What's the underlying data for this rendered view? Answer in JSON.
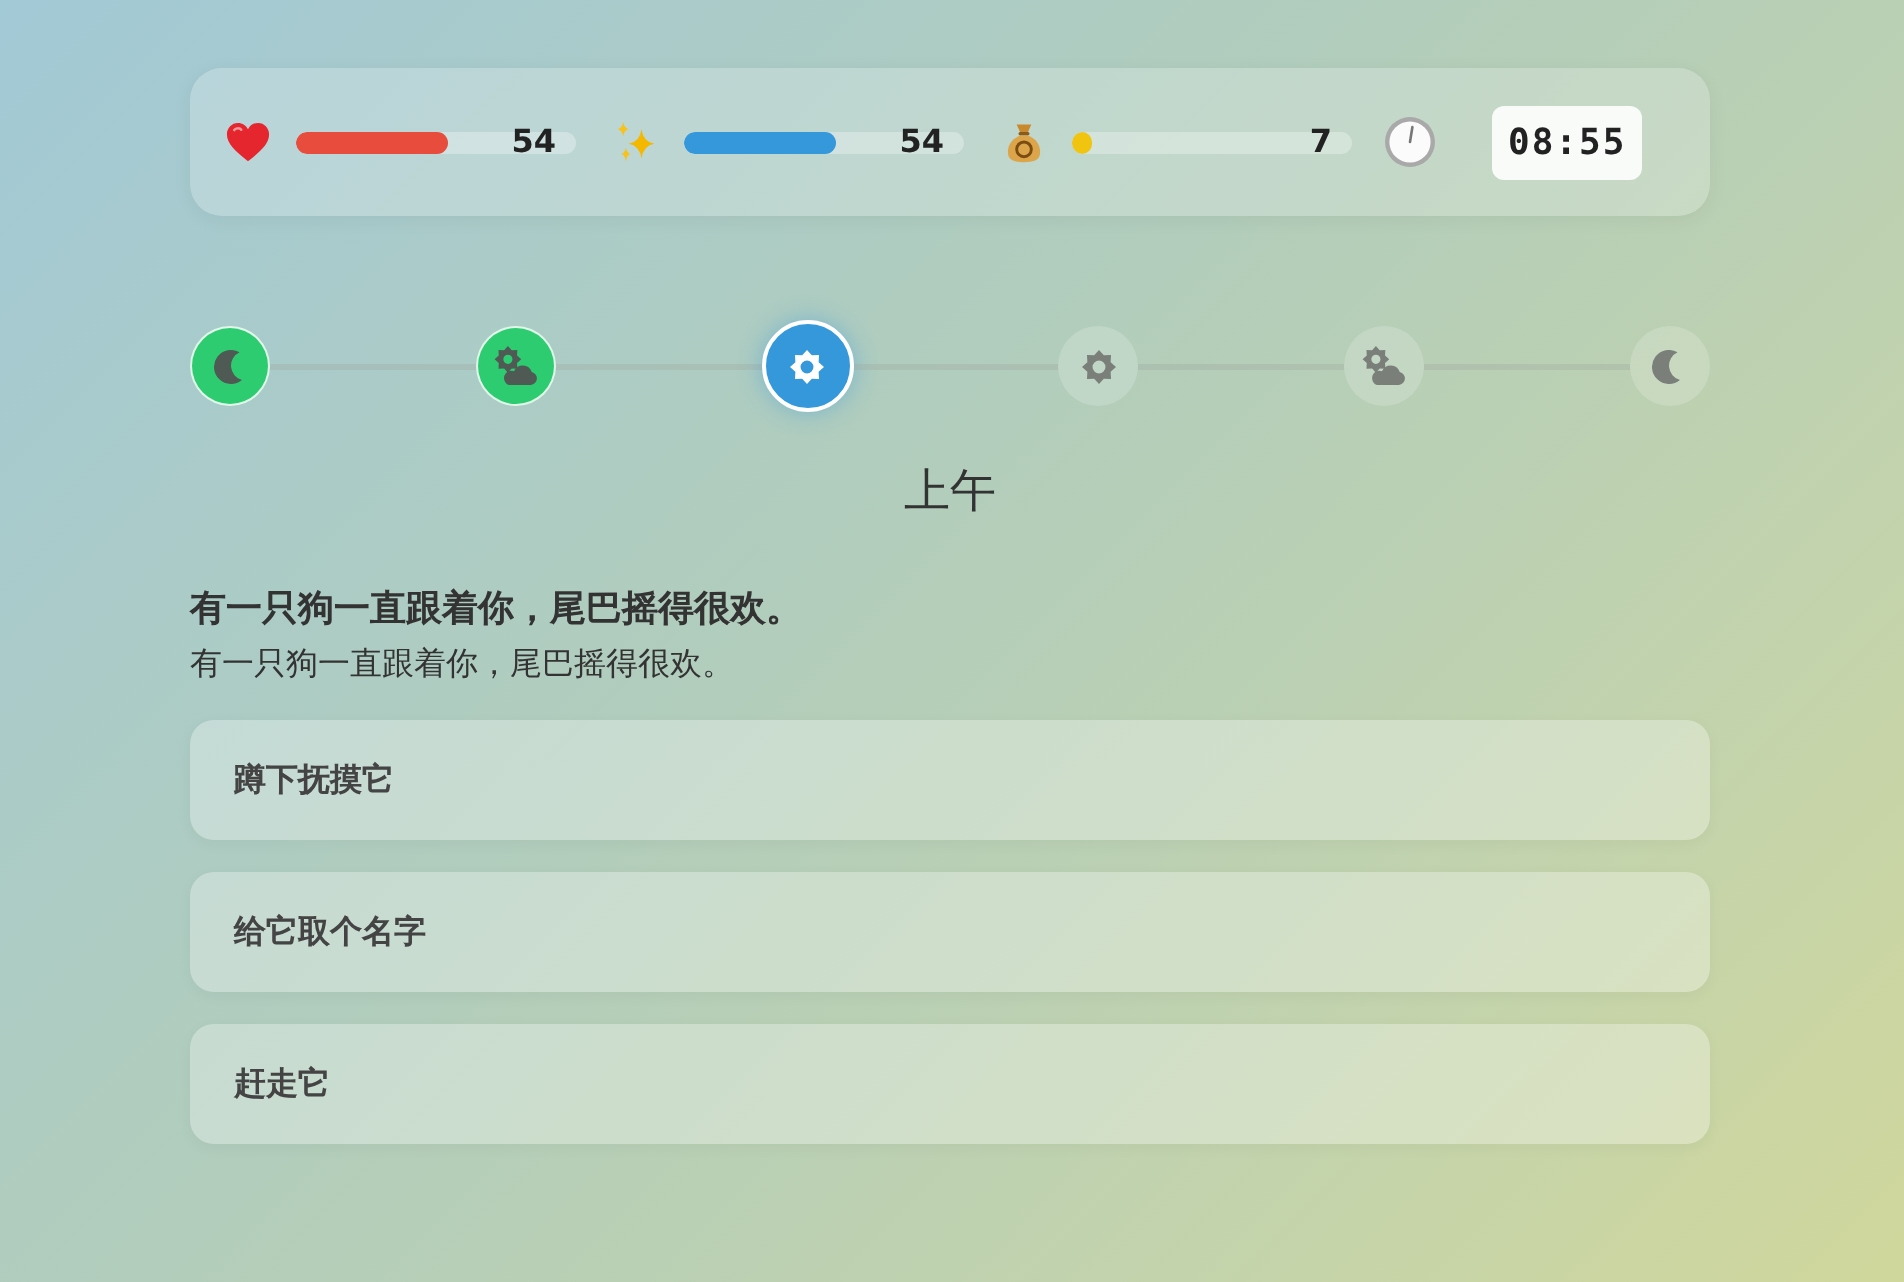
{
  "status_bar": {
    "stats": [
      {
        "kind": "health",
        "value": "54",
        "level": 0.54,
        "color": "#e74c3c"
      },
      {
        "kind": "energy",
        "value": "54",
        "level": 0.54,
        "color": "#3498db"
      },
      {
        "kind": "money",
        "value": "7",
        "level": 0.07,
        "color": "#f1c40f"
      }
    ],
    "clock": {
      "time": "08:55"
    }
  },
  "timeline": {
    "phases": [
      {
        "kind": "moon",
        "completed": true,
        "selected": false
      },
      {
        "kind": "sun_cloud",
        "completed": true,
        "selected": false
      },
      {
        "kind": "sun",
        "completed": false,
        "selected": true
      },
      {
        "kind": "sun",
        "completed": false,
        "selected": false
      },
      {
        "kind": "sun_cloud",
        "completed": false,
        "selected": false
      },
      {
        "kind": "moon",
        "completed": false,
        "selected": false
      }
    ],
    "current_label": "上午"
  },
  "story": {
    "title": "有一只狗一直跟着你，尾巴摇得很欢。",
    "text": "有一只狗一直跟着你，尾巴摇得很欢。"
  },
  "choices": [
    {
      "label": "蹲下抚摸它"
    },
    {
      "label": "给它取个名字"
    },
    {
      "label": "赶走它"
    }
  ]
}
